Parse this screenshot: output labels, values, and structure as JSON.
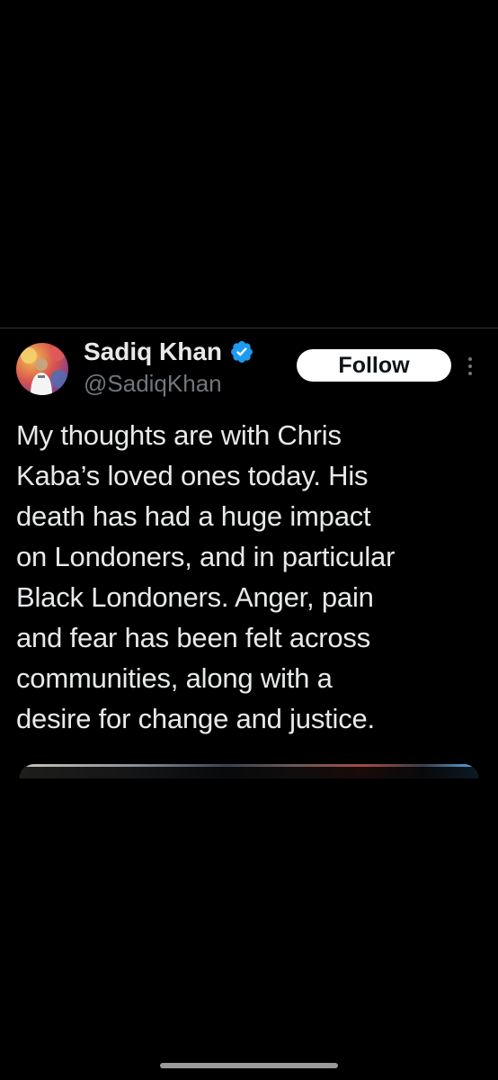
{
  "tweet": {
    "author": {
      "display_name": "Sadiq Khan",
      "handle": "@SadiqKhan",
      "verified": true,
      "verified_color": "#1d9bf0",
      "avatar_icon": "avatar-photo"
    },
    "follow_label": "Follow",
    "more_icon": "more-vertical-icon",
    "text": "My thoughts are with Chris\nKaba’s loved ones today. His\ndeath has had a huge impact\non Londoners, and in particular\nBlack Londoners. Anger, pain\nand fear has been felt across\ncommunities, along with a\ndesire for change and justice."
  },
  "colors": {
    "background": "#000000",
    "text_primary": "#e7e9ea",
    "text_secondary": "#71767b",
    "button_bg": "#ffffff",
    "button_text": "#0f1419"
  }
}
